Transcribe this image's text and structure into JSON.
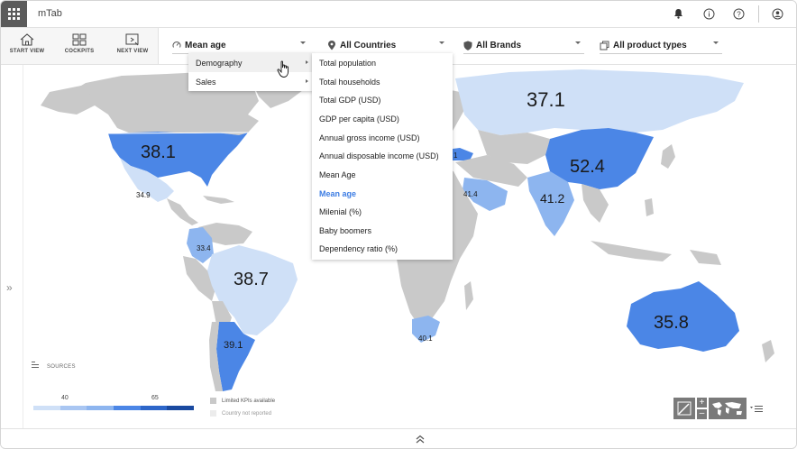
{
  "app": {
    "title": "mTab"
  },
  "nav": {
    "start_view": "START VIEW",
    "cockpits": "COCKPITS",
    "next_view": "NEXT VIEW"
  },
  "filters": {
    "metric": "Mean age",
    "countries": "All Countries",
    "brands": "All Brands",
    "product_types": "All product types"
  },
  "category_menu": [
    {
      "label": "Demography"
    },
    {
      "label": "Sales"
    }
  ],
  "metric_menu": {
    "items": [
      "Total population",
      "Total households",
      "Total GDP (USD)",
      "GDP per capita (USD)",
      "Annual gross income (USD)",
      "Annual disposable income (USD)",
      "Mean Age",
      "Mean age",
      "Milenial (%)",
      "Baby boomers",
      "Dependency ratio (%)"
    ],
    "selected": "Mean age"
  },
  "map_values": {
    "usa": "38.1",
    "mexico": "34.9",
    "colombia": "33.4",
    "brazil": "38.7",
    "argentina": "39.1",
    "russia": "37.1",
    "china": "52.4",
    "india": "41.2",
    "saudi": "41.4",
    "turkey": "1",
    "south_africa": "40.1",
    "australia": "35.8"
  },
  "legend": {
    "sources": "SOURCES",
    "tick_low": "40",
    "tick_high": "65",
    "limited": "Limited KPIs available",
    "not_reported": "Country not reported"
  },
  "colors": {
    "land_gray": "#c9c9c9",
    "light_blue": "#cfe0f7",
    "mid_blue": "#8db5ef",
    "blue": "#4b86e6",
    "accent": "#3d7de3",
    "ocean": "#ffffff"
  }
}
